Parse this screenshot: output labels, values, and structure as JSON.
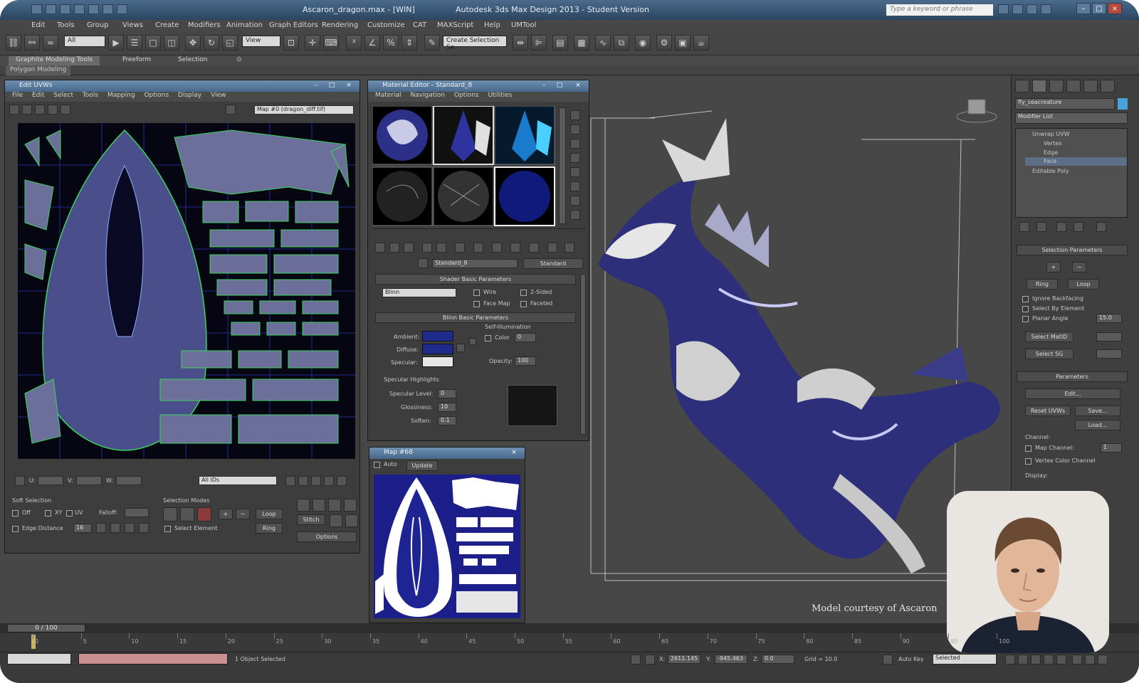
{
  "window": {
    "title_left": "Ascaron_dragon.max - [WIN]",
    "title_center": "Autodesk 3ds Max Design 2013 - Student Version",
    "search_placeholder": "Type a keyword or phrase"
  },
  "menu": [
    "Edit",
    "Tools",
    "Group",
    "Views",
    "Create",
    "Modifiers",
    "Animation",
    "Graph Editors",
    "Rendering",
    "Customize",
    "CAT",
    "MAXScript",
    "Help",
    "UMTool"
  ],
  "toolbar": {
    "selection_filter": "All",
    "ref_coord": "View",
    "named_selection": "Create Selection Se"
  },
  "ribbon": {
    "tabs": [
      "Graphite Modeling Tools",
      "Freeform",
      "Selection"
    ],
    "sub_label": "Polygon Modeling"
  },
  "uv_editor": {
    "title": "Edit UVWs",
    "menu": [
      "File",
      "Edit",
      "Select",
      "Tools",
      "Mapping",
      "Options",
      "Display",
      "View"
    ],
    "map_dropdown": "Map #0 (dragon_diff.tif)",
    "bottom_u": "U:",
    "bottom_v": "V:",
    "bottom_w": "W:",
    "id_dropdown": "All IDs",
    "soft_selection_label": "Soft Selection",
    "soft_xy": "XY",
    "soft_uv": "UV",
    "soft_off": "Off",
    "falloff_label": "Falloff:",
    "edge_distance": "Edge Distance",
    "edge_distance_value": "16",
    "selection_modes_label": "Selection Modes",
    "select_element": "Select Element",
    "loop": "Loop",
    "ring": "Ring",
    "stitch": "Stitch",
    "options": "Options"
  },
  "material_editor": {
    "title": "Material Editor - Standard_8",
    "menu": [
      "Material",
      "Navigation",
      "Options",
      "Utilities"
    ],
    "material_name": "Standard_8",
    "material_type": "Standard",
    "shader_rollout": "Shader Basic Parameters",
    "shader_type": "Blinn",
    "wire": "Wire",
    "two_sided": "2-Sided",
    "face_map": "Face Map",
    "faceted": "Faceted",
    "blinn_rollout": "Blinn Basic Parameters",
    "self_illumination": "Self-Illumination",
    "color_label": "Color",
    "color_value": "0",
    "ambient": "Ambient:",
    "diffuse": "Diffuse:",
    "specular": "Specular:",
    "opacity_label": "Opacity:",
    "opacity_value": "100",
    "specular_highlights": "Specular Highlights",
    "specular_level": "Specular Level:",
    "specular_level_value": "0",
    "glossiness": "Glossiness:",
    "glossiness_value": "10",
    "soften": "Soften:",
    "soften_value": "0.1"
  },
  "map_preview": {
    "title": "Map #68",
    "auto": "Auto",
    "update": "Update"
  },
  "command_panel": {
    "object_name": "fly_seacreature",
    "modifier_list": "Modifier List",
    "stack": [
      "Unwrap UVW",
      "Vertex",
      "Edge",
      "Face",
      "Editable Poly"
    ],
    "selection_params": "Selection Parameters",
    "ring": "Ring",
    "loop": "Loop",
    "ignore_backfacing": "Ignore Backfacing",
    "select_by_element": "Select By Element",
    "planar_angle": "Planar Angle",
    "planar_angle_value": "15.0",
    "select_matid": "Select MatID",
    "select_sg": "Select SG",
    "parameters": "Parameters",
    "edit": "Edit...",
    "reset_uvws": "Reset UVWs",
    "save": "Save...",
    "load": "Load...",
    "channel": "Channel:",
    "map_channel": "Map Channel:",
    "map_channel_value": "1",
    "vertex_color_channel": "Vertex Color Channel",
    "display": "Display:"
  },
  "timeline": {
    "frame_counter": "0 / 100",
    "ticks": [
      "0",
      "5",
      "10",
      "15",
      "20",
      "25",
      "30",
      "35",
      "40",
      "45",
      "50",
      "55",
      "60",
      "65",
      "70",
      "75",
      "80",
      "85",
      "90",
      "95",
      "100"
    ]
  },
  "status": {
    "objects_selected": "1 Object Selected",
    "x_value": "2611.145",
    "y_value": "-945.463",
    "z_value": "0.0",
    "grid": "Grid = 10.0",
    "auto_key": "Auto Key",
    "selected": "Selected"
  },
  "viewport": {
    "credit": "Model courtesy of Ascaron"
  }
}
